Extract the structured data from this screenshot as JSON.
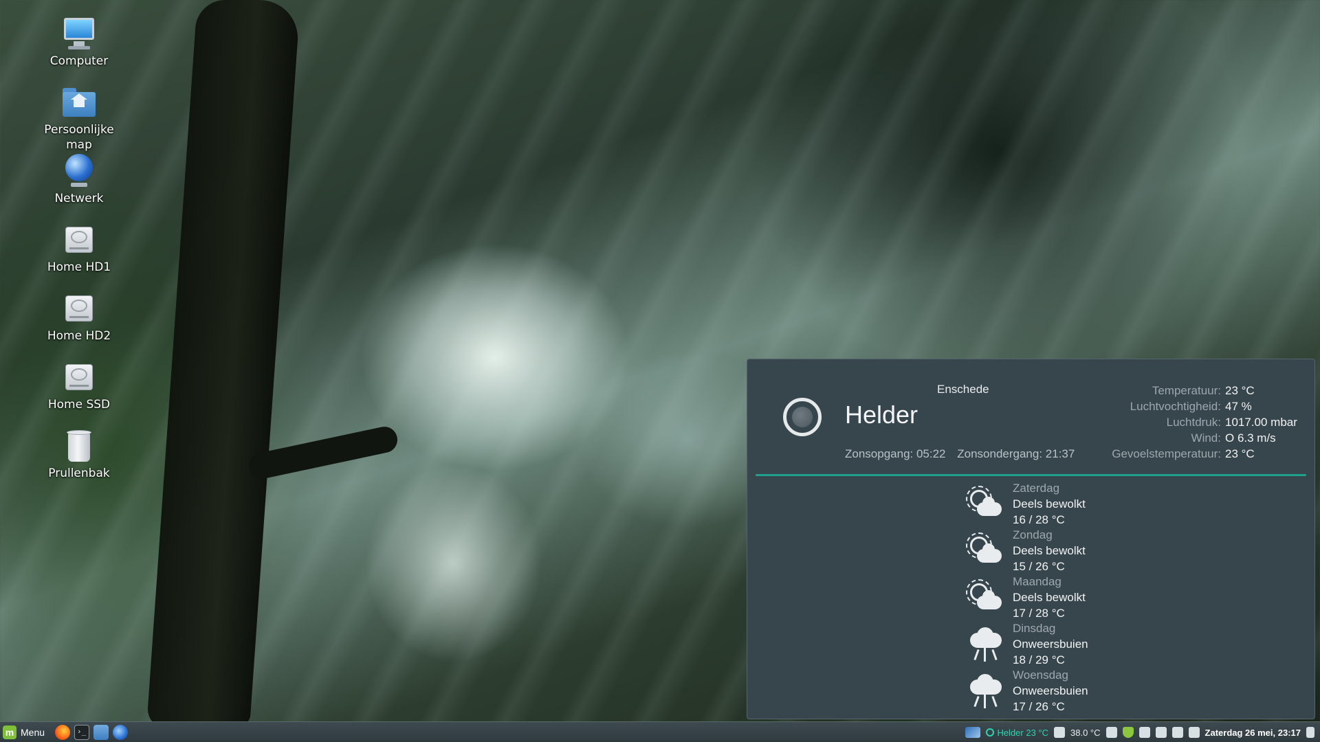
{
  "desktop": {
    "icons": [
      {
        "label": "Computer",
        "icon": "computer-icon"
      },
      {
        "label": "Persoonlijke\nmap",
        "icon": "home-folder-icon"
      },
      {
        "label": "Netwerk",
        "icon": "network-icon"
      },
      {
        "label": "Home HD1",
        "icon": "hard-drive-icon"
      },
      {
        "label": "Home HD2",
        "icon": "hard-drive-icon"
      },
      {
        "label": "Home SSD",
        "icon": "hard-drive-icon"
      },
      {
        "label": "Prullenbak",
        "icon": "trash-icon"
      }
    ]
  },
  "weather": {
    "city": "Enschede",
    "condition": "Helder",
    "icon": "clear-night-icon",
    "sunrise": "Zonsopgang: 05:22",
    "sunset": "Zonsondergang: 21:37",
    "details": [
      {
        "label": "Temperatuur:",
        "value": "23 °C"
      },
      {
        "label": "Luchtvochtigheid:",
        "value": "47 %"
      },
      {
        "label": "Luchtdruk:",
        "value": "1017.00 mbar"
      },
      {
        "label": "Wind:",
        "value": "O 6.3 m/s"
      },
      {
        "label": "Gevoelstemperatuur:",
        "value": "23 °C"
      }
    ],
    "accent": "#1ea08a",
    "forecast": [
      {
        "day": "Zaterdag",
        "desc": "Deels bewolkt",
        "temp": "16 / 28 °C",
        "icon": "partly-cloudy-icon"
      },
      {
        "day": "Zondag",
        "desc": "Deels bewolkt",
        "temp": "15 / 26 °C",
        "icon": "partly-cloudy-icon"
      },
      {
        "day": "Maandag",
        "desc": "Deels bewolkt",
        "temp": "17 / 28 °C",
        "icon": "partly-cloudy-icon"
      },
      {
        "day": "Dinsdag",
        "desc": "Onweersbuien",
        "temp": "18 / 29 °C",
        "icon": "thunderstorm-icon"
      },
      {
        "day": "Woensdag",
        "desc": "Onweersbuien",
        "temp": "17 / 26 °C",
        "icon": "thunderstorm-icon"
      }
    ]
  },
  "taskbar": {
    "menu_label": "Menu",
    "weather_applet": "Helder 23 °C",
    "temperature_applet": "38.0 °C",
    "clock": "Zaterdag 26 mei, 23:17"
  }
}
